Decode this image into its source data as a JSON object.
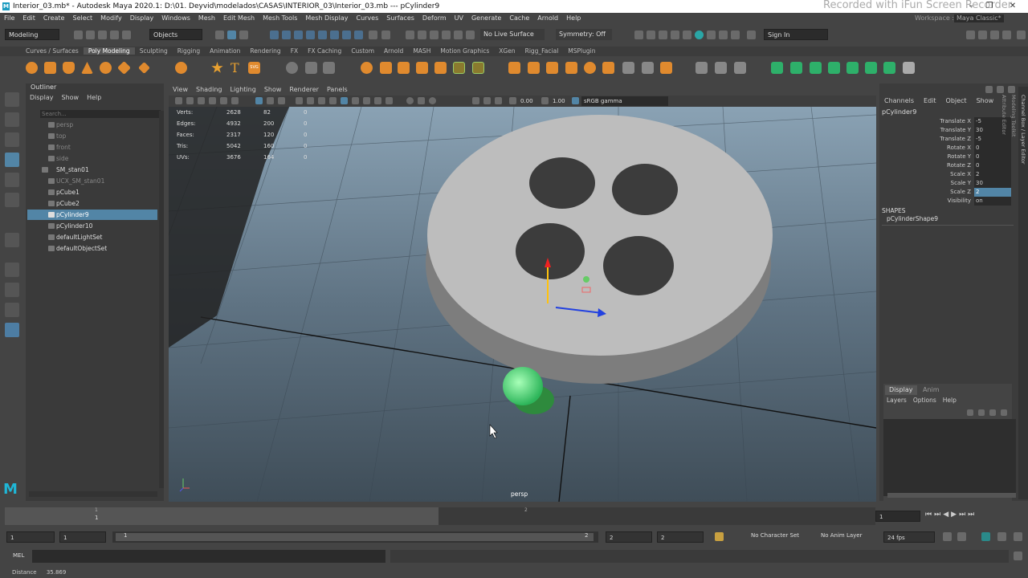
{
  "window": {
    "title": "Interior_03.mb* - Autodesk Maya 2020.1: D:\\01. Deyvid\\modelados\\CASAS\\INTERIOR_03\\Interior_03.mb  ---  pCylinder9",
    "watermark": "Recorded with iFun Screen Recorder",
    "minimize": "–",
    "maximize": "❐",
    "close": "✕"
  },
  "menus": [
    "File",
    "Edit",
    "Create",
    "Select",
    "Modify",
    "Display",
    "Windows",
    "Mesh",
    "Edit Mesh",
    "Mesh Tools",
    "Mesh Display",
    "Curves",
    "Surfaces",
    "Deform",
    "UV",
    "Generate",
    "Cache",
    "Arnold",
    "Help"
  ],
  "workspace": {
    "label": "Workspace :",
    "value": "Maya Classic*"
  },
  "status_line": {
    "mode": "Modeling",
    "selection_mask": "Objects",
    "live_surface": "No Live Surface",
    "symmetry": "Symmetry: Off",
    "sign_in": "Sign In"
  },
  "shelf_tabs": [
    "Curves / Surfaces",
    "Poly Modeling",
    "Sculpting",
    "Rigging",
    "Animation",
    "Rendering",
    "FX",
    "FX Caching",
    "Custom",
    "Arnold",
    "MASH",
    "Motion Graphics",
    "XGen",
    "Rigg_Facial",
    "MSPlugin"
  ],
  "shelf_active_tab": "Poly Modeling",
  "outliner": {
    "title": "Outliner",
    "menus": [
      "Display",
      "Show",
      "Help"
    ],
    "search_placeholder": "Search...",
    "items": [
      {
        "label": "persp",
        "state": "dim"
      },
      {
        "label": "top",
        "state": "dim"
      },
      {
        "label": "front",
        "state": "dim"
      },
      {
        "label": "side",
        "state": "dim"
      },
      {
        "label": "SM_stan01",
        "state": "normal"
      },
      {
        "label": "UCX_SM_stan01",
        "state": "dim"
      },
      {
        "label": "pCube1",
        "state": "normal"
      },
      {
        "label": "pCube2",
        "state": "normal"
      },
      {
        "label": "pCylinder9",
        "state": "selected"
      },
      {
        "label": "pCylinder10",
        "state": "normal"
      },
      {
        "label": "defaultLightSet",
        "state": "normal"
      },
      {
        "label": "defaultObjectSet",
        "state": "normal"
      }
    ]
  },
  "viewport": {
    "menus": [
      "View",
      "Shading",
      "Lighting",
      "Show",
      "Renderer",
      "Panels"
    ],
    "exposure": "0.00",
    "gamma": "1.00",
    "color_space": "sRGB gamma",
    "camera": "persp",
    "hud": [
      {
        "label": "Verts:",
        "total": "2628",
        "sel": "82",
        "comp": "0"
      },
      {
        "label": "Edges:",
        "total": "4932",
        "sel": "200",
        "comp": "0"
      },
      {
        "label": "Faces:",
        "total": "2317",
        "sel": "120",
        "comp": "0"
      },
      {
        "label": "Tris:",
        "total": "5042",
        "sel": "160",
        "comp": "0"
      },
      {
        "label": "UVs:",
        "total": "3676",
        "sel": "164",
        "comp": "0"
      }
    ]
  },
  "channel_box": {
    "menus": [
      "Channels",
      "Edit",
      "Object",
      "Show"
    ],
    "object": "pCylinder9",
    "attributes": [
      {
        "name": "Translate X",
        "value": "-5"
      },
      {
        "name": "Translate Y",
        "value": "30"
      },
      {
        "name": "Translate Z",
        "value": "-5"
      },
      {
        "name": "Rotate X",
        "value": "0"
      },
      {
        "name": "Rotate Y",
        "value": "0"
      },
      {
        "name": "Rotate Z",
        "value": "0"
      },
      {
        "name": "Scale X",
        "value": "2"
      },
      {
        "name": "Scale Y",
        "value": "30"
      },
      {
        "name": "Scale Z",
        "value": "2"
      },
      {
        "name": "Visibility",
        "value": "on"
      }
    ],
    "highlighted_attribute": "Scale Z",
    "shapes_header": "SHAPES",
    "shape": "pCylinderShape9",
    "side_tabs": [
      "Channel Box / Layer Editor",
      "Modeling Toolkit",
      "Attribute Editor"
    ]
  },
  "layer_editor": {
    "tabs": [
      "Display",
      "Anim"
    ],
    "menus": [
      "Layers",
      "Options",
      "Help"
    ]
  },
  "time_slider": {
    "tick_start": "1",
    "tick_mid": "2",
    "current_frame": "1"
  },
  "range_slider": {
    "start": "1",
    "range_start": "1",
    "range_inner_start": "1",
    "range_inner_end": "2",
    "range_end": "2",
    "end": "2",
    "character_set": "No Character Set",
    "anim_layer": "No Anim Layer",
    "fps": "24 fps"
  },
  "command_line": {
    "lang": "MEL"
  },
  "help_line": {
    "label": "Distance",
    "value": "35.869"
  }
}
